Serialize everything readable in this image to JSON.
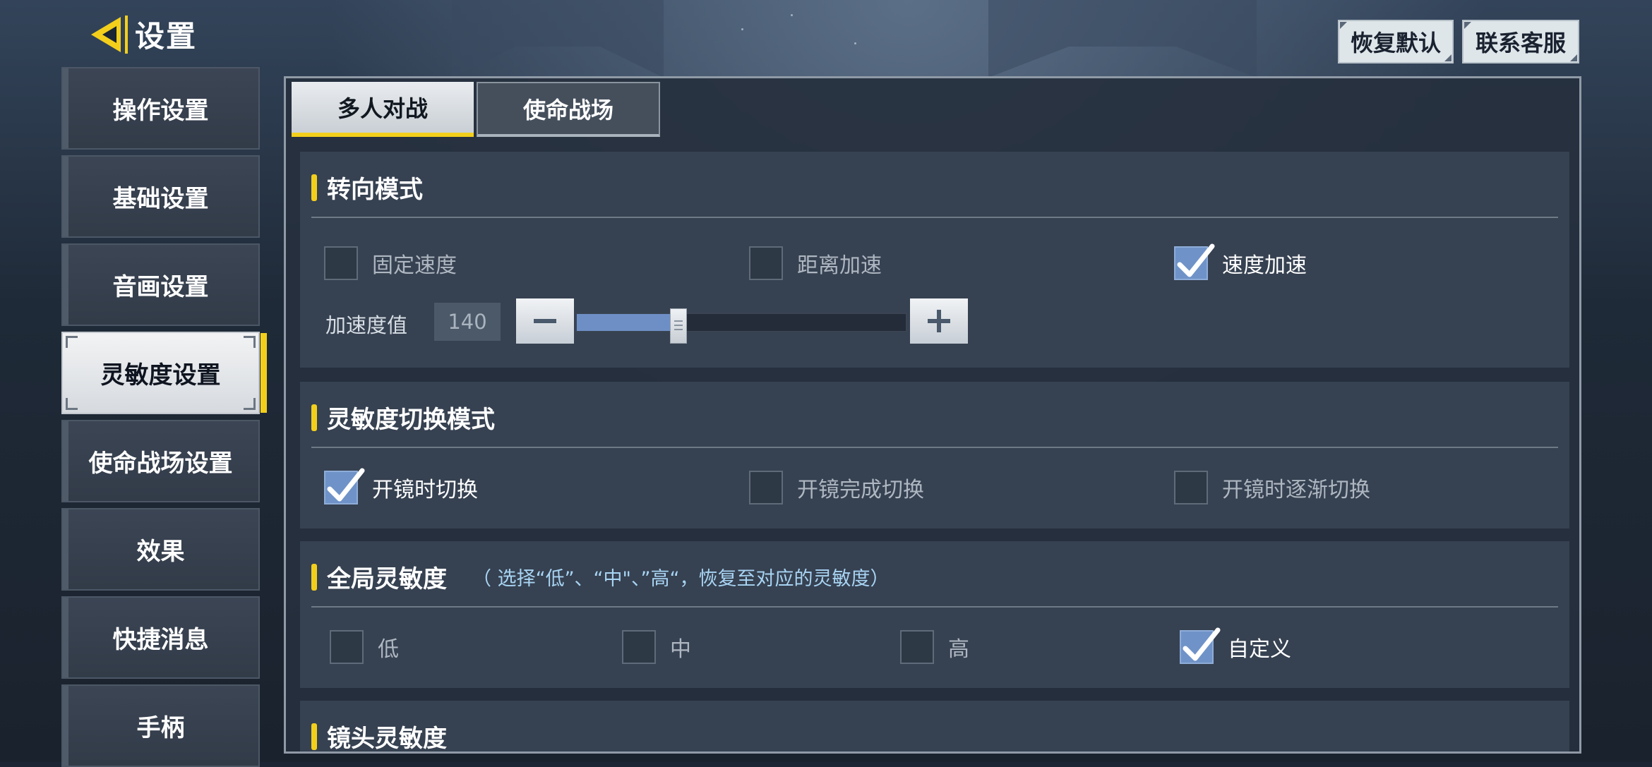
{
  "header": {
    "title": "设置",
    "buttons": {
      "restore_default": "恢复默认",
      "contact_support": "联系客服"
    }
  },
  "sidebar": {
    "items": [
      {
        "label": "操作设置",
        "active": false
      },
      {
        "label": "基础设置",
        "active": false
      },
      {
        "label": "音画设置",
        "active": false
      },
      {
        "label": "灵敏度设置",
        "active": true
      },
      {
        "label": "使命战场设置",
        "active": false
      },
      {
        "label": "效果",
        "active": false
      },
      {
        "label": "快捷消息",
        "active": false
      },
      {
        "label": "手柄",
        "active": false
      }
    ]
  },
  "tabs": [
    {
      "label": "多人对战",
      "active": true
    },
    {
      "label": "使命战场",
      "active": false
    }
  ],
  "sections": {
    "turning": {
      "title": "转向模式",
      "options": [
        {
          "label": "固定速度",
          "checked": false
        },
        {
          "label": "距离加速",
          "checked": false
        },
        {
          "label": "速度加速",
          "checked": true
        }
      ],
      "acceleration": {
        "label": "加速度值",
        "value": "140",
        "level": 0.31
      }
    },
    "switch_mode": {
      "title": "灵敏度切换模式",
      "options": [
        {
          "label": "开镜时切换",
          "checked": true
        },
        {
          "label": "开镜完成切换",
          "checked": false
        },
        {
          "label": "开镜时逐渐切换",
          "checked": false
        }
      ]
    },
    "global": {
      "title": "全局灵敏度",
      "note": "（ 选择“低”、“中\"、”高“，恢复至对应的灵敏度）",
      "options": [
        {
          "label": "低",
          "checked": false
        },
        {
          "label": "中",
          "checked": false
        },
        {
          "label": "高",
          "checked": false
        },
        {
          "label": "自定义",
          "checked": true
        }
      ]
    },
    "scope": {
      "title": "镜头灵敏度"
    }
  },
  "colors": {
    "accent": "#f3cf1c",
    "check": "#6f93c8"
  }
}
